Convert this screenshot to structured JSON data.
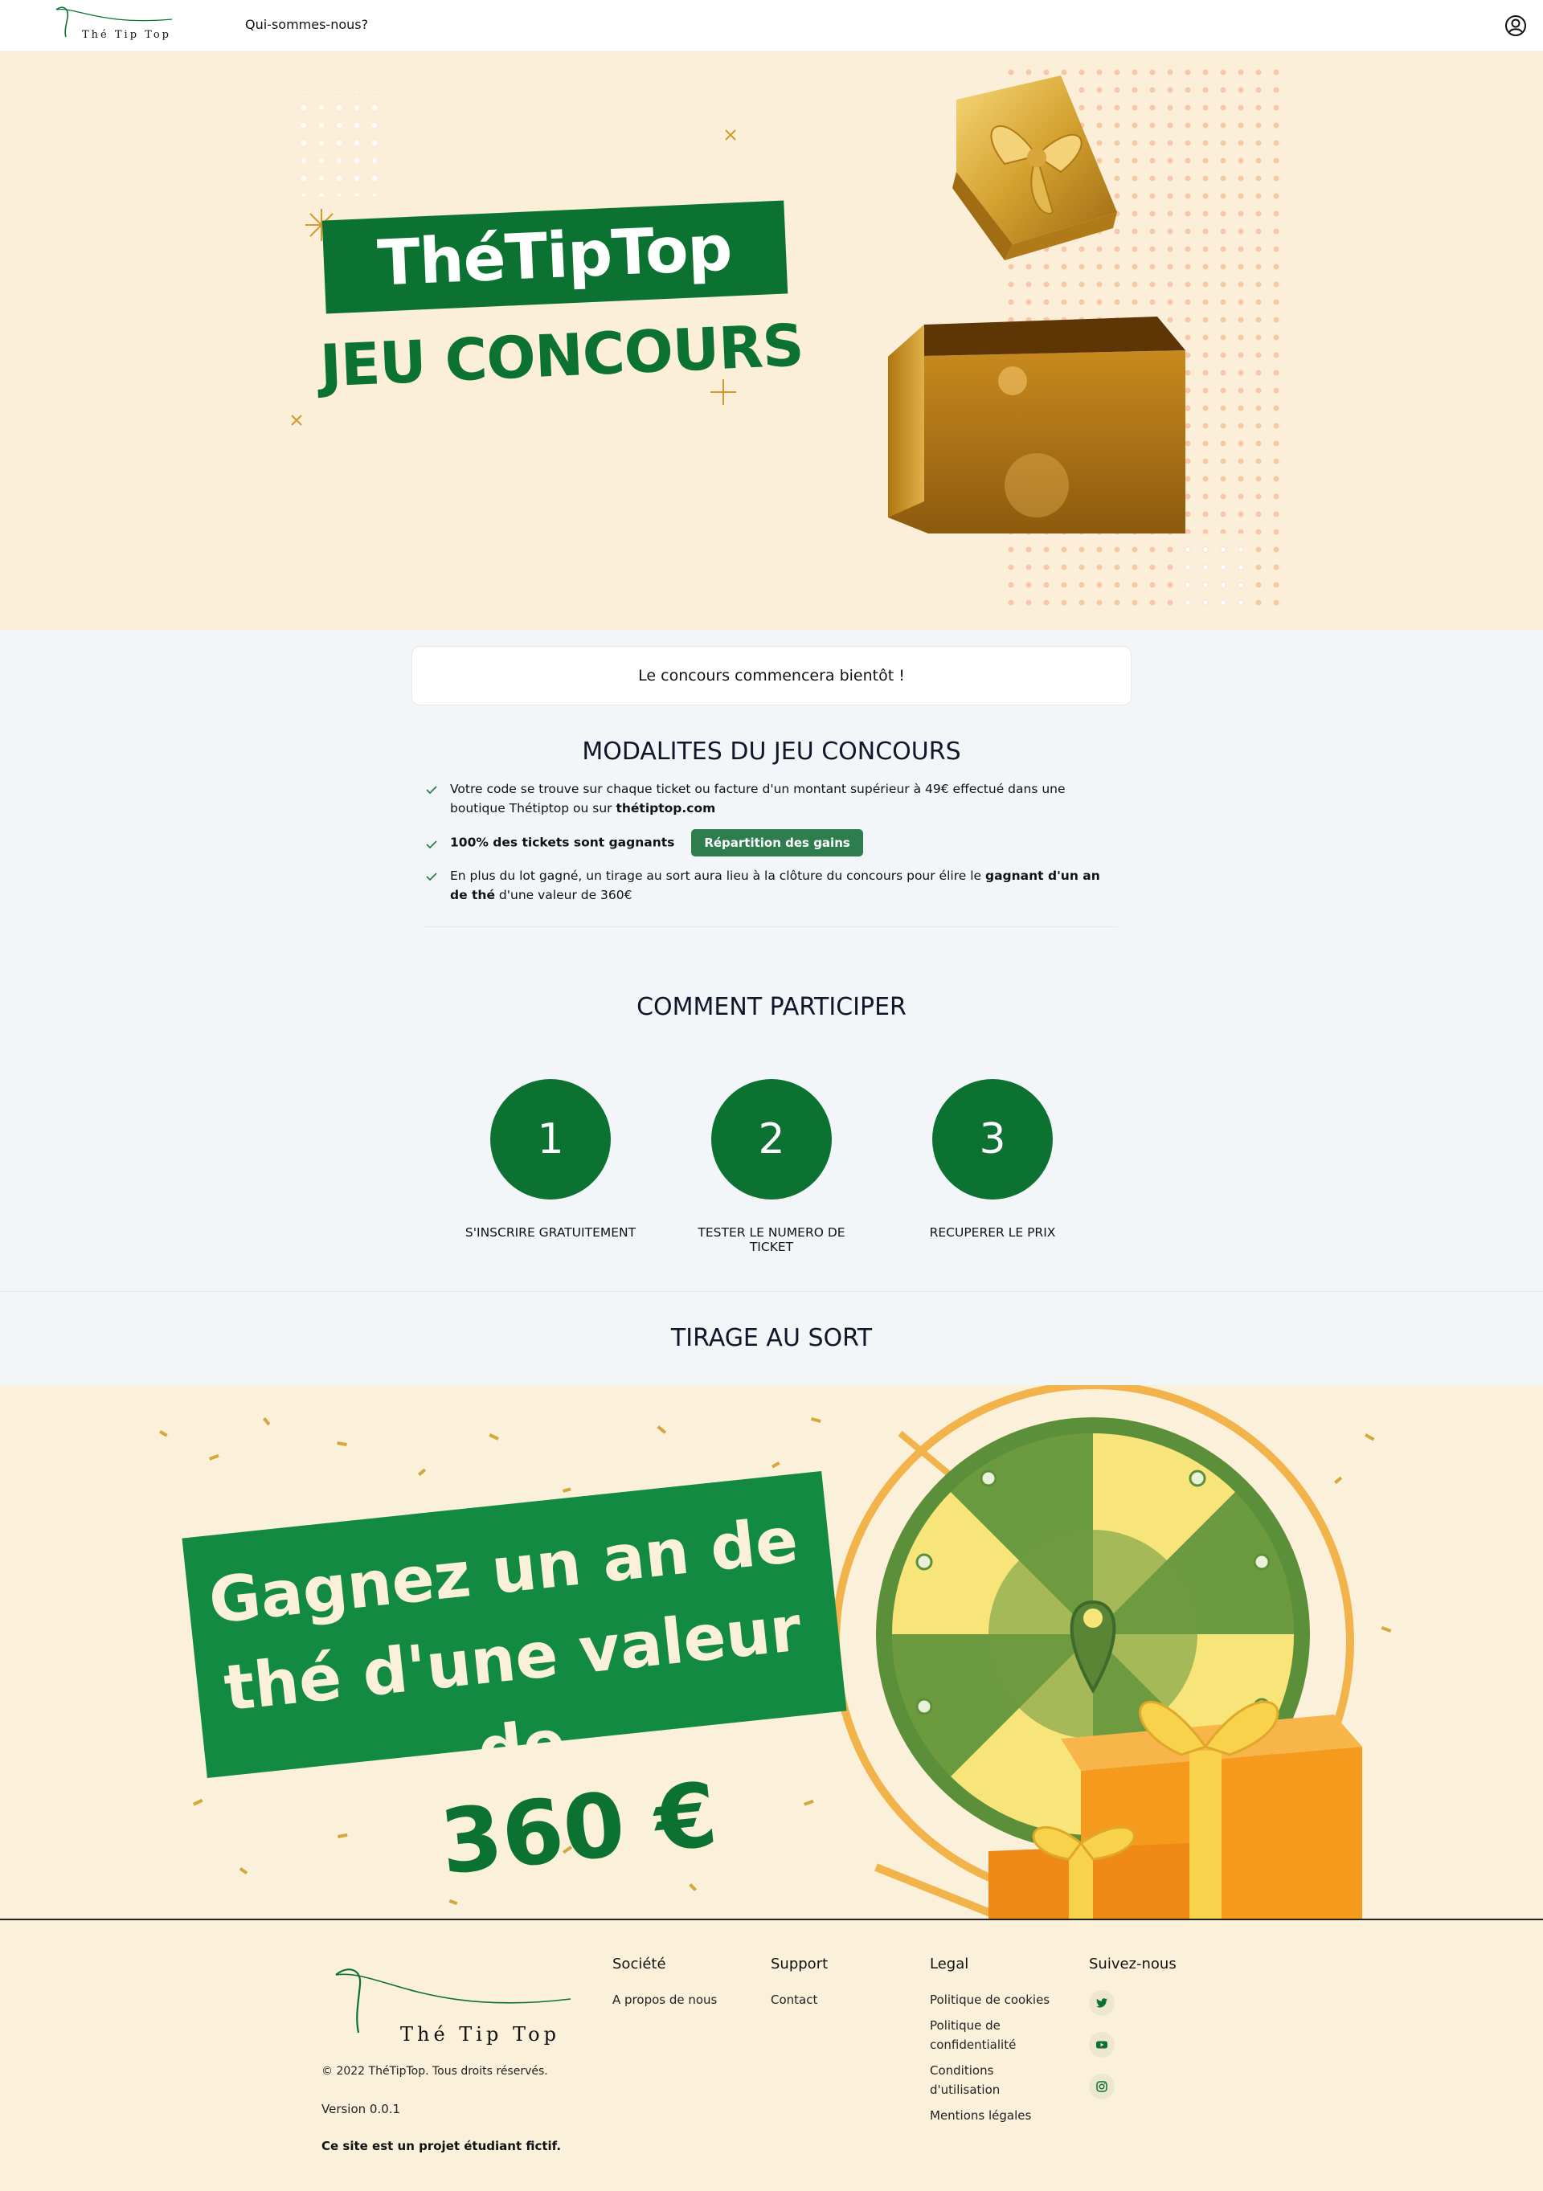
{
  "nav": {
    "logo_text": "Thé Tip Top",
    "link": "Qui-sommes-nous?",
    "user_icon": "user-circle-icon"
  },
  "hero": {
    "title": "ThéTipTop",
    "subtitle": "JEU CONCOURS"
  },
  "notice": "Le concours commencera bientôt !",
  "rules": {
    "title": "MODALITES DU JEU CONCOURS",
    "r1_text": "Votre code se trouve sur chaque ticket ou facture d'un montant supérieur à 49€ effectué dans une boutique Thétiptop ou sur ",
    "r1_link": "thétiptop.com",
    "r2_text": "100% des tickets sont gagnants",
    "r2_button": "Répartition des gains",
    "r3_prefix": "En plus du lot gagné, un tirage au sort aura lieu à la clôture du concours pour élire le ",
    "r3_bold": "gagnant d'un an de thé",
    "r3_suffix": " d'une valeur de 360€"
  },
  "steps": {
    "title": "COMMENT PARTICIPER",
    "items": [
      {
        "number": "1",
        "label": "S'INSCRIRE GRATUITEMENT"
      },
      {
        "number": "2",
        "label": "TESTER LE NUMERO DE TICKET"
      },
      {
        "number": "3",
        "label": "RECUPERER LE PRIX"
      }
    ]
  },
  "draw": {
    "title": "TIRAGE AU SORT",
    "banner_line1": "Gagnez un an de",
    "banner_line2": "thé d'une valeur de",
    "amount": "360 €"
  },
  "footer": {
    "logo_text": "Thé Tip Top",
    "copyright": "© 2022 ThéTipTop. Tous droits réservés.",
    "version": "Version 0.0.1",
    "fictional": "Ce site est un projet étudiant fictif.",
    "columns": {
      "societe": {
        "head": "Société",
        "items": [
          "A propos de nous"
        ]
      },
      "support": {
        "head": "Support",
        "items": [
          "Contact"
        ]
      },
      "legal": {
        "head": "Legal",
        "items": [
          "Politique de cookies",
          "Politique de confidentialité",
          "Conditions d'utilisation",
          "Mentions légales"
        ]
      },
      "social": {
        "head": "Suivez-nous",
        "icons": [
          "twitter-icon",
          "youtube-icon",
          "instagram-icon"
        ]
      }
    }
  },
  "colors": {
    "brand_green": "#0b7232",
    "button_green": "#2e7d4f",
    "cream": "#fbefd9",
    "page_bg": "#f2f6f9"
  }
}
